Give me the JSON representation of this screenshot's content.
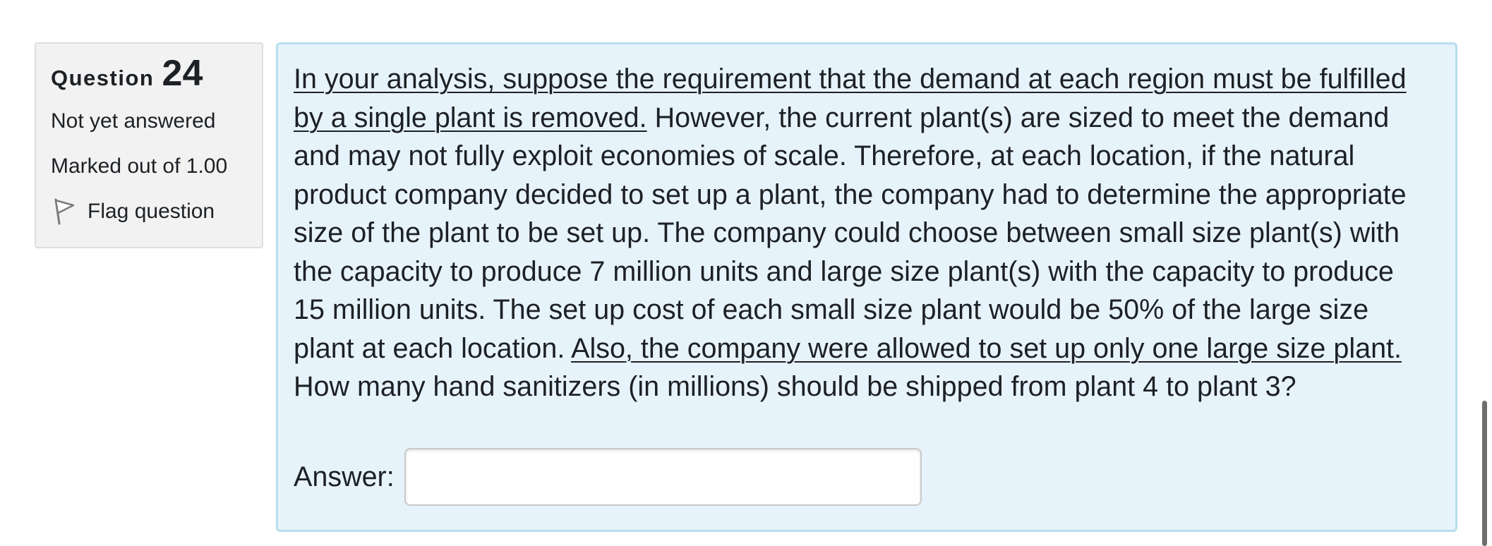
{
  "question": {
    "label": "Question",
    "number": "24",
    "state": "Not yet answered",
    "grade": "Marked out of 1.00",
    "flag_label": "Flag question",
    "flag_icon": "flag-icon"
  },
  "question_text": {
    "underlined_1": "In your analysis, suppose the requirement that the demand at each region must be fulfilled by a single plant is removed.",
    "plain_1": "  However, the current plant(s) are sized to meet the demand and may not fully exploit economies of scale. Therefore, at each location, if the natural product company decided to set up a plant, the company had to determine the appropriate size of the plant to be set up. The company could choose between small size plant(s) with the capacity to produce 7 million units and large size plant(s) with the capacity to produce 15 million units. The set up cost of each small size plant would be 50% of the large size plant at each location. ",
    "underlined_2": "Also, the company were allowed to set up only one large size plant.",
    "plain_2": "How many hand sanitizers (in millions) should be shipped from plant 4 to plant 3?"
  },
  "answer": {
    "label": "Answer:",
    "value": "",
    "placeholder": ""
  },
  "colors": {
    "info_bg": "#f2f2f2",
    "content_bg": "#e7f3fb",
    "content_border": "#b7deed",
    "text": "#1d2125"
  }
}
